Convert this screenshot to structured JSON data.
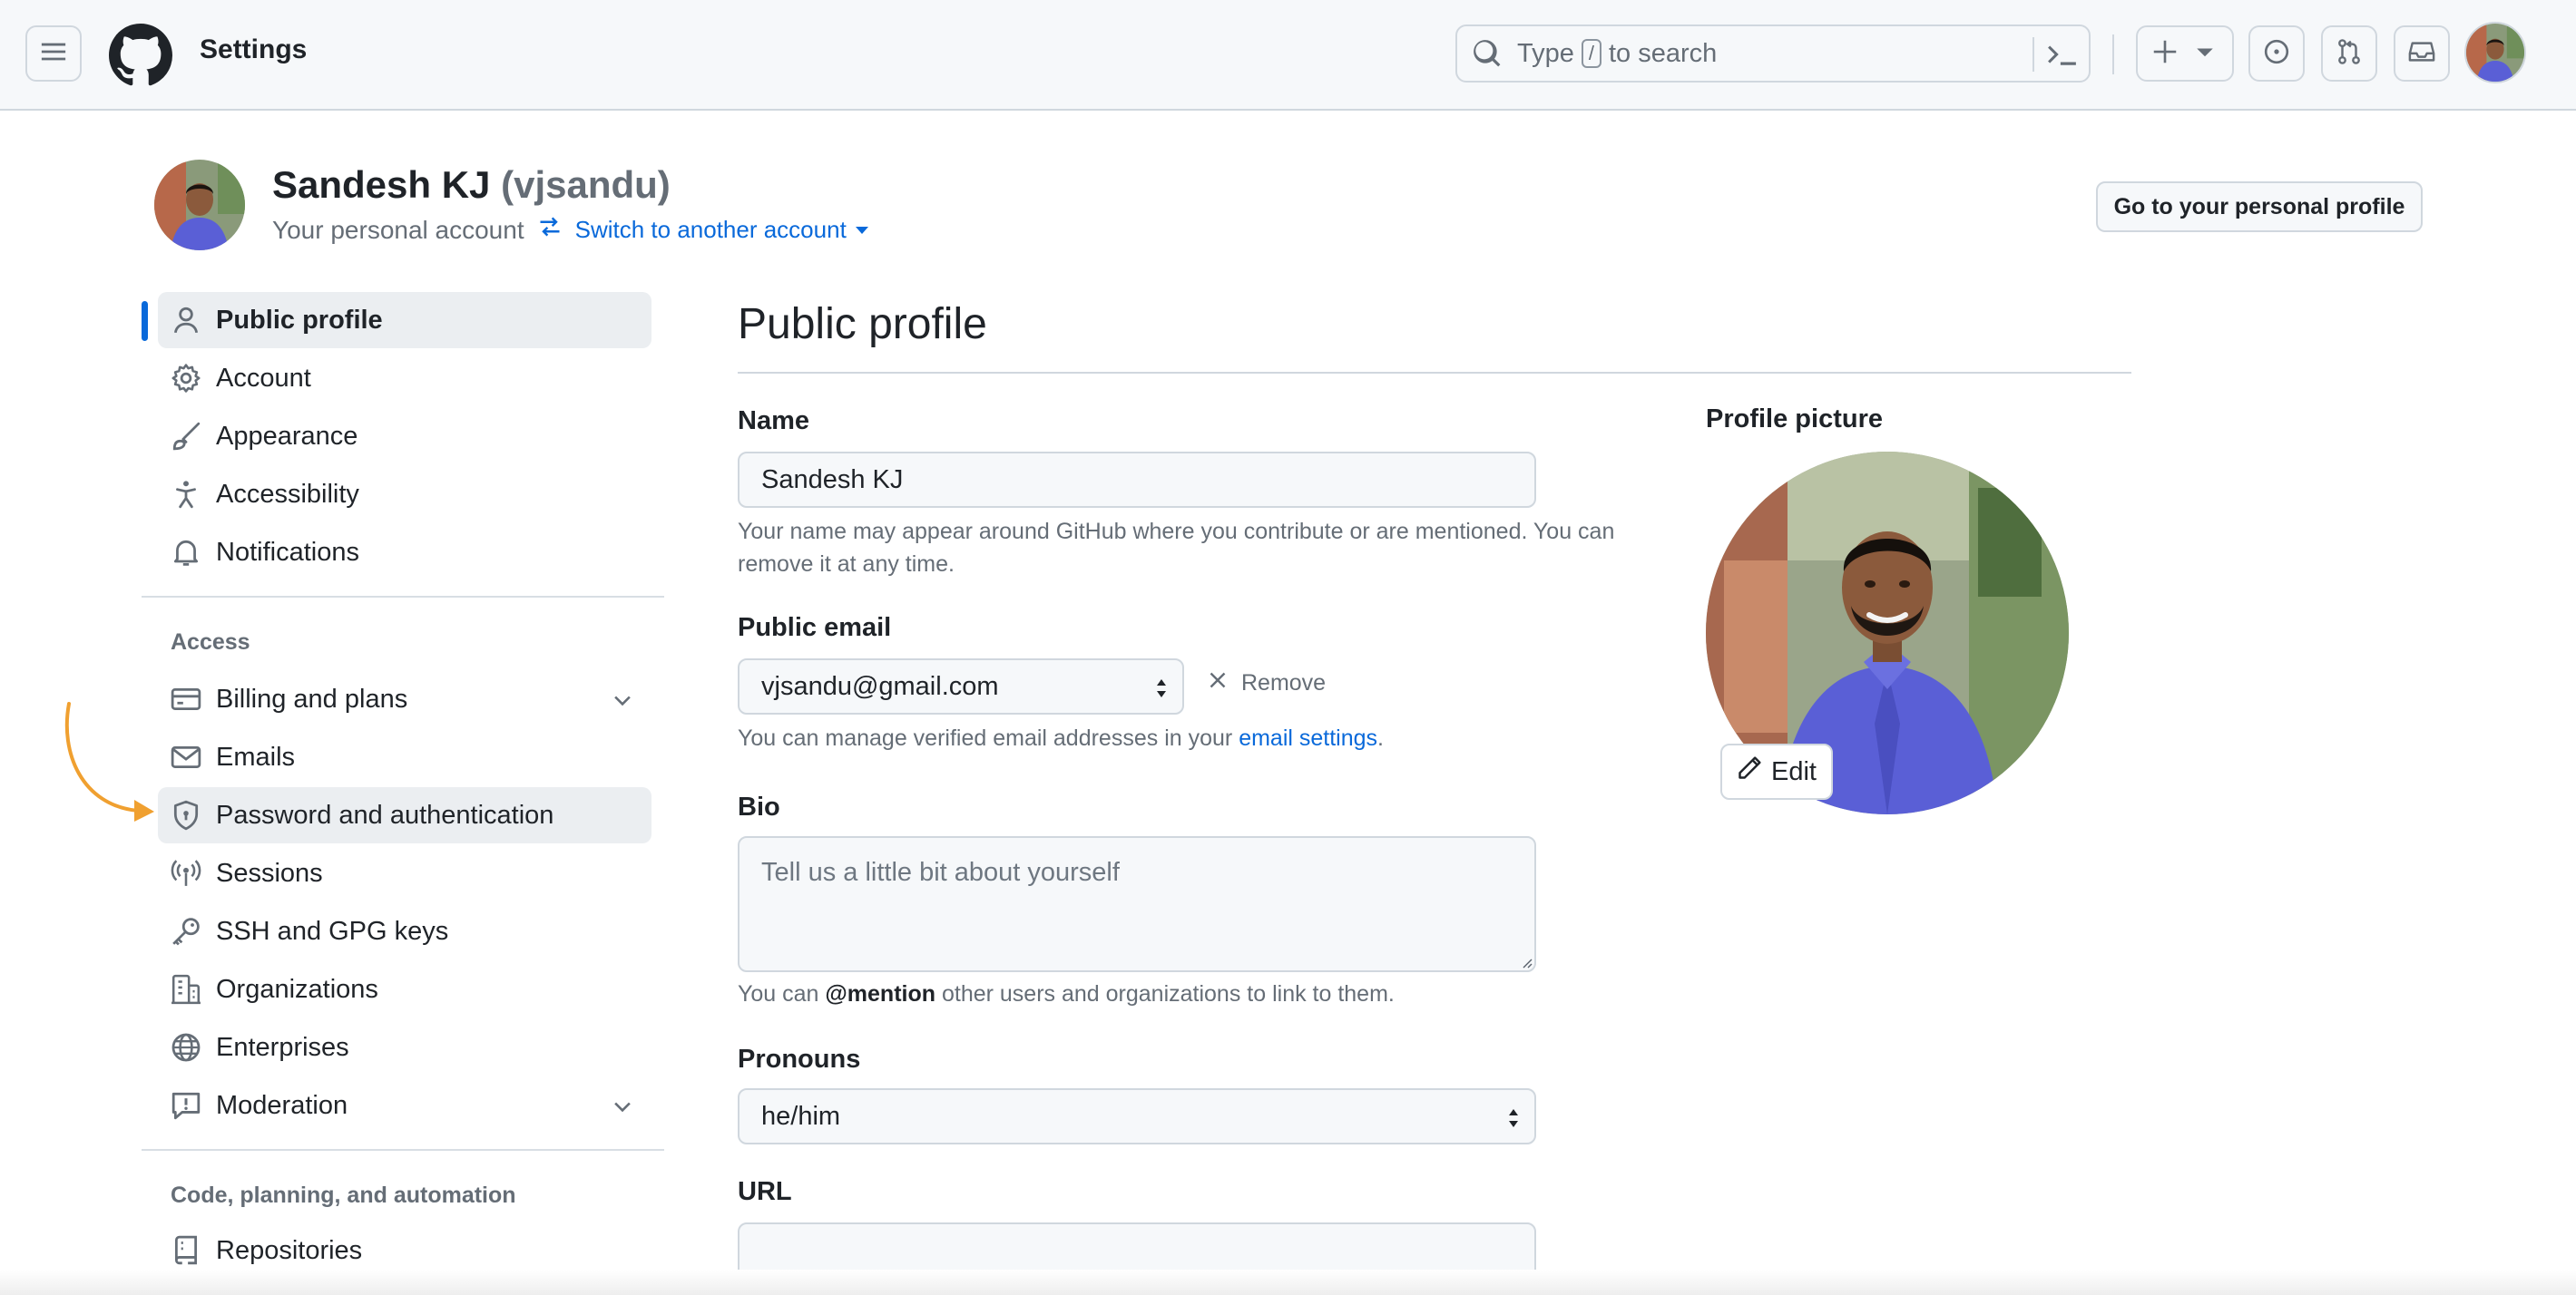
{
  "header": {
    "context_title": "Settings",
    "search_prefix": "Type",
    "search_key": "/",
    "search_suffix": "to search",
    "icons": [
      "hamburger-icon",
      "github-logo",
      "search-icon",
      "command-palette-icon",
      "plus-icon",
      "issues-icon",
      "pull-requests-icon",
      "inbox-icon"
    ]
  },
  "account": {
    "name": "Sandesh KJ",
    "handle": "(vjsandu)",
    "subtitle": "Your personal account",
    "switch_label": "Switch to another account",
    "profile_button": "Go to your personal profile"
  },
  "sidebar": {
    "items_top": [
      {
        "label": "Public profile",
        "icon": "person-icon",
        "active": true
      },
      {
        "label": "Account",
        "icon": "gear-icon"
      },
      {
        "label": "Appearance",
        "icon": "paintbrush-icon"
      },
      {
        "label": "Accessibility",
        "icon": "accessibility-icon"
      },
      {
        "label": "Notifications",
        "icon": "bell-icon"
      }
    ],
    "access_heading": "Access",
    "items_access": [
      {
        "label": "Billing and plans",
        "icon": "credit-card-icon",
        "expandable": true
      },
      {
        "label": "Emails",
        "icon": "mail-icon"
      },
      {
        "label": "Password and authentication",
        "icon": "shield-lock-icon",
        "highlighted": true
      },
      {
        "label": "Sessions",
        "icon": "broadcast-icon"
      },
      {
        "label": "SSH and GPG keys",
        "icon": "key-icon"
      },
      {
        "label": "Organizations",
        "icon": "organization-icon"
      },
      {
        "label": "Enterprises",
        "icon": "globe-icon"
      },
      {
        "label": "Moderation",
        "icon": "report-icon",
        "expandable": true
      }
    ],
    "code_heading": "Code, planning, and automation",
    "items_code": [
      {
        "label": "Repositories",
        "icon": "repo-icon"
      }
    ]
  },
  "main": {
    "title": "Public profile",
    "name_label": "Name",
    "name_value": "Sandesh KJ",
    "name_help": "Your name may appear around GitHub where you contribute or are mentioned. You can remove it at any time.",
    "email_label": "Public email",
    "email_value": "vjsandu@gmail.com",
    "remove_label": "Remove",
    "email_help_prefix": "You can manage verified email addresses in your",
    "email_help_link": "email settings",
    "email_help_suffix": ".",
    "bio_label": "Bio",
    "bio_placeholder": "Tell us a little bit about yourself",
    "bio_help_prefix": "You can",
    "bio_help_mention": "@mention",
    "bio_help_suffix": "other users and organizations to link to them.",
    "pronouns_label": "Pronouns",
    "pronouns_value": "he/him",
    "url_label": "URL",
    "url_value": ""
  },
  "profile_picture": {
    "label": "Profile picture",
    "edit_label": "Edit"
  },
  "colors": {
    "accent": "#0969da",
    "annotation_arrow": "#f0a030",
    "shirt": "#5a5fd6"
  }
}
